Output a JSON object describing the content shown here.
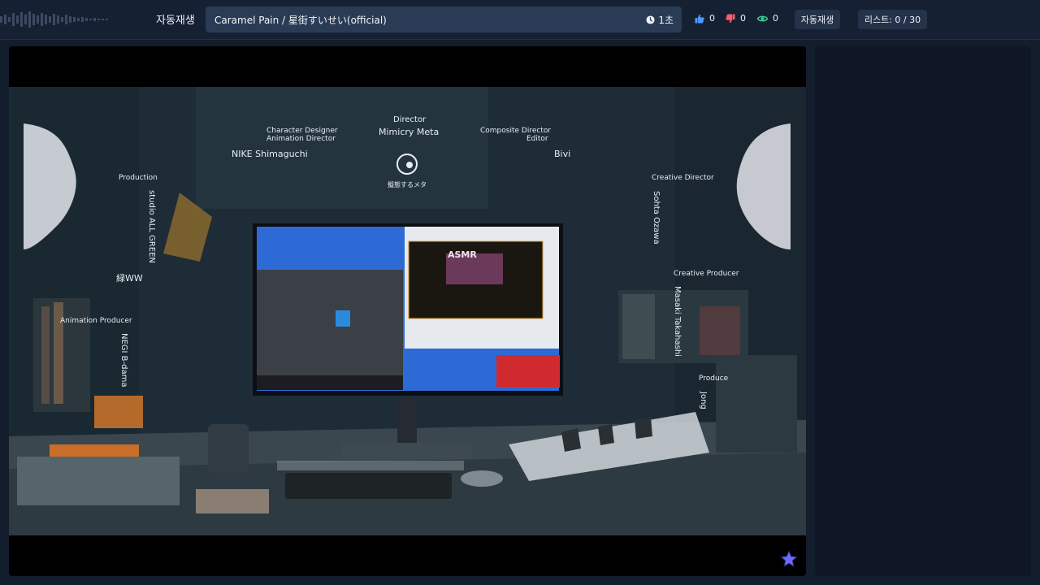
{
  "header": {
    "autoplay_label": "자동재생",
    "now_playing_title": "Caramel Pain / 星街すいせい(official)",
    "duration": "1초",
    "likes": "0",
    "dislikes": "0",
    "views": "0",
    "autoplay_button": "자동재생",
    "list_count": "리스트: 0 / 30"
  },
  "video_credits": {
    "director_role": "Director",
    "director_name": "Mimicry Meta",
    "director_logo_text": "擬態するメタ",
    "char_designer_role_1": "Character Designer",
    "char_designer_role_2": "Animation Director",
    "char_designer_name": "NIKE Shimaguchi",
    "composite_role_1": "Composite Director",
    "composite_role_2": "Editor",
    "composite_name": "Bivi",
    "production_role": "Production",
    "production_name": "studio ALL GREEN",
    "production_logo_text": "緑WW",
    "anim_producer_role": "Animation Producer",
    "anim_producer_name": "NEGI B-dama",
    "creative_director_role": "Creative Director",
    "creative_director_name": "Sohta Ozawa",
    "creative_producer_role": "Creative Producer",
    "creative_producer_name": "Masaki Takahashi",
    "produce_role": "Produce",
    "produce_name": "Jong",
    "screen_badge": "ASMR"
  },
  "icons": {
    "clock": "clock-icon",
    "like": "thumbs-up-icon",
    "dislike": "thumbs-down-icon",
    "views": "eye-icon",
    "star": "star-icon"
  },
  "colors": {
    "like": "#4a9bff",
    "dislike": "#ff5a6e",
    "views": "#35d18f",
    "star": "#6b6bff"
  }
}
